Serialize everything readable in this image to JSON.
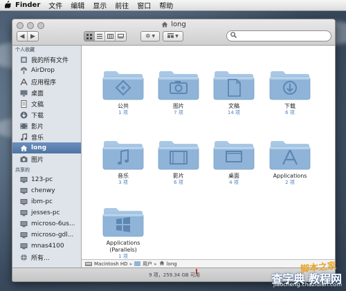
{
  "colors": {
    "selection": "#5b7fb0",
    "folder_body": "#8fb4d8",
    "folder_tab": "#a9c8e6",
    "count_text": "#4d7fc0",
    "watermark_orange": "#e8a52a"
  },
  "menubar": {
    "apple_icon": "apple-logo",
    "app": "Finder",
    "items": [
      "文件",
      "编辑",
      "显示",
      "前往",
      "窗口",
      "帮助"
    ]
  },
  "window": {
    "title": "long",
    "search": {
      "placeholder": "",
      "icon": "magnifier-icon"
    }
  },
  "sidebar": {
    "sections": [
      {
        "heading": "个人收藏",
        "items": [
          {
            "label": "我的所有文件",
            "icon": "all-files-icon"
          },
          {
            "label": "AirDrop",
            "icon": "airdrop-icon"
          },
          {
            "label": "应用程序",
            "icon": "applications-icon"
          },
          {
            "label": "桌面",
            "icon": "desktop-icon"
          },
          {
            "label": "文稿",
            "icon": "documents-icon"
          },
          {
            "label": "下载",
            "icon": "downloads-icon"
          },
          {
            "label": "影片",
            "icon": "movies-icon"
          },
          {
            "label": "音乐",
            "icon": "music-icon"
          },
          {
            "label": "long",
            "icon": "home-icon",
            "selected": true
          },
          {
            "label": "图片",
            "icon": "pictures-icon"
          }
        ]
      },
      {
        "heading": "共享的",
        "items": [
          {
            "label": "123-pc",
            "icon": "computer-icon"
          },
          {
            "label": "chenwy",
            "icon": "computer-icon"
          },
          {
            "label": "ibm-pc",
            "icon": "computer-icon"
          },
          {
            "label": "jesses-pc",
            "icon": "computer-icon"
          },
          {
            "label": "microso-6us...",
            "icon": "computer-icon"
          },
          {
            "label": "microso-gdl...",
            "icon": "computer-icon"
          },
          {
            "label": "mnas4100",
            "icon": "computer-icon"
          },
          {
            "label": "所有...",
            "icon": "network-icon"
          }
        ]
      }
    ]
  },
  "folders": [
    {
      "name": "公共",
      "count": "1 项",
      "glyph": "public"
    },
    {
      "name": "图片",
      "count": "7 项",
      "glyph": "camera"
    },
    {
      "name": "文稿",
      "count": "14 项",
      "glyph": "document"
    },
    {
      "name": "下载",
      "count": "6 项",
      "glyph": "download"
    },
    {
      "name": "音乐",
      "count": "3 项",
      "glyph": "music"
    },
    {
      "name": "影片",
      "count": "6 项",
      "glyph": "film"
    },
    {
      "name": "桌面",
      "count": "4 项",
      "glyph": "desktop"
    },
    {
      "name": "Applications",
      "count": "2 项",
      "glyph": "appstore"
    },
    {
      "name": "Applications\n(Parallels)",
      "count": "1 项",
      "glyph": "windows"
    }
  ],
  "pathbar": {
    "segments": [
      "Macintosh HD",
      "用户",
      "long"
    ],
    "separator": "▸"
  },
  "status": "9 项，259.34 GB 可用",
  "watermark": {
    "line1": "脚本之家",
    "line2": "查字典 教程网",
    "line3": "jiaocheng.chazidian.com"
  }
}
